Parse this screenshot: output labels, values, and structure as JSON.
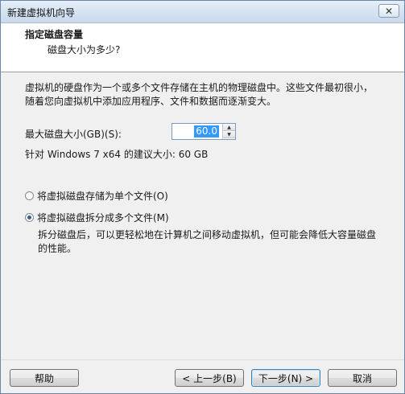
{
  "window": {
    "title": "新建虚拟机向导",
    "close_glyph": "✕"
  },
  "header": {
    "title": "指定磁盘容量",
    "subtitle": "磁盘大小为多少?"
  },
  "description": "虚拟机的硬盘作为一个或多个文件存储在主机的物理磁盘中。这些文件最初很小，随着您向虚拟机中添加应用程序、文件和数据而逐渐变大。",
  "disk_size": {
    "label": "最大磁盘大小(GB)(S):",
    "value": "60.0"
  },
  "suggestion": "针对 Windows 7 x64 的建议大小: 60 GB",
  "options": {
    "single_file": {
      "label": "将虚拟磁盘存储为单个文件(O)",
      "selected": false
    },
    "split_files": {
      "label": "将虚拟磁盘拆分成多个文件(M)",
      "selected": true
    },
    "split_description": "拆分磁盘后，可以更轻松地在计算机之间移动虚拟机，但可能会降低大容量磁盘的性能。"
  },
  "buttons": {
    "help": "帮助",
    "back": "< 上一步(B)",
    "next": "下一步(N) >",
    "cancel": "取消"
  }
}
